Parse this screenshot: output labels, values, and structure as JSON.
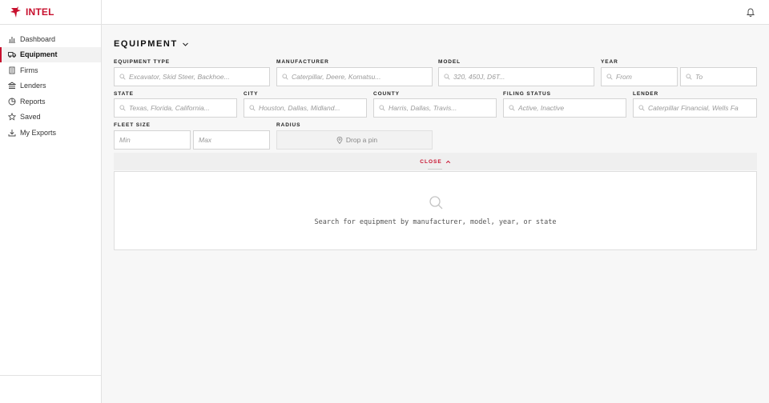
{
  "brand": {
    "name": "INTEL",
    "color": "#c8102e"
  },
  "sidebar": {
    "items": [
      {
        "label": "Dashboard",
        "icon": "bar-chart-icon",
        "active": false
      },
      {
        "label": "Equipment",
        "icon": "truck-icon",
        "active": true
      },
      {
        "label": "Firms",
        "icon": "building-icon",
        "active": false
      },
      {
        "label": "Lenders",
        "icon": "bank-icon",
        "active": false
      },
      {
        "label": "Reports",
        "icon": "pie-chart-icon",
        "active": false
      },
      {
        "label": "Saved",
        "icon": "star-icon",
        "active": false
      },
      {
        "label": "My Exports",
        "icon": "download-icon",
        "active": false
      }
    ]
  },
  "topbar": {
    "icon": "bell-icon"
  },
  "page": {
    "title": "EQUIPMENT"
  },
  "filters": {
    "equipment_type": {
      "label": "EQUIPMENT TYPE",
      "placeholder": "Excavator, Skid Steer, Backhoe..."
    },
    "manufacturer": {
      "label": "MANUFACTURER",
      "placeholder": "Caterpillar, Deere, Komatsu..."
    },
    "model": {
      "label": "MODEL",
      "placeholder": "320, 450J, D6T..."
    },
    "year": {
      "label": "YEAR",
      "from_placeholder": "From",
      "to_placeholder": "To"
    },
    "state": {
      "label": "STATE",
      "placeholder": "Texas, Florida, California..."
    },
    "city": {
      "label": "CITY",
      "placeholder": "Houston, Dallas, Midland..."
    },
    "county": {
      "label": "COUNTY",
      "placeholder": "Harris, Dallas, Travis..."
    },
    "filing_status": {
      "label": "FILING STATUS",
      "placeholder": "Active, Inactive"
    },
    "lender": {
      "label": "LENDER",
      "placeholder": "Caterpillar Financial, Wells Fa"
    },
    "fleet_size": {
      "label": "FLEET SIZE",
      "min_placeholder": "Min",
      "max_placeholder": "Max"
    },
    "radius": {
      "label": "RADIUS",
      "button": "Drop a pin"
    }
  },
  "toggle": {
    "label": "CLOSE"
  },
  "results": {
    "empty_message": "Search for equipment by manufacturer, model, year, or state"
  }
}
